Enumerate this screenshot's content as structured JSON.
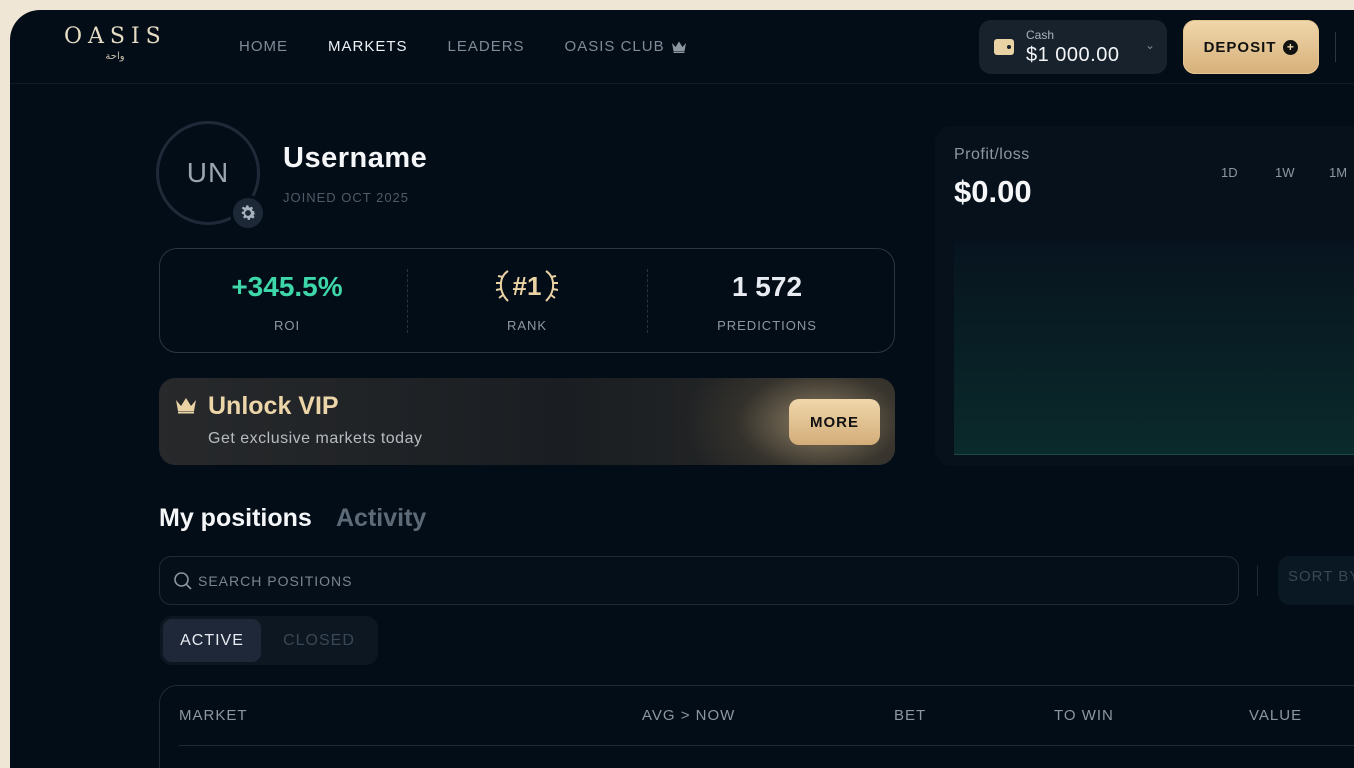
{
  "brand": {
    "name": "OASIS",
    "subtitle": "واحة"
  },
  "nav": {
    "home": "HOME",
    "markets": "MARKETS",
    "leaders": "LEADERS",
    "club": "OASIS CLUB",
    "active": "markets"
  },
  "cash": {
    "label": "Cash",
    "value": "$1 000.00"
  },
  "deposit": {
    "label": "DEPOSIT"
  },
  "profile": {
    "initials": "UN",
    "username": "Username",
    "joined": "JOINED OCT 2025"
  },
  "stats": {
    "roi": {
      "value": "+345.5%",
      "label": "ROI"
    },
    "rank": {
      "value": "#1",
      "label": "RANK"
    },
    "predictions": {
      "value": "1 572",
      "label": "PREDICTIONS"
    }
  },
  "vip": {
    "title": "Unlock VIP",
    "subtitle": "Get exclusive markets today",
    "button": "MORE"
  },
  "pnl": {
    "label": "Profit/loss",
    "value": "$0.00",
    "ranges": [
      "1D",
      "1W",
      "1M"
    ]
  },
  "positions": {
    "tabs": {
      "main": "My positions",
      "other": "Activity"
    },
    "search_placeholder": "SEARCH POSITIONS",
    "sort_label": "SORT BY",
    "filter": {
      "active": "ACTIVE",
      "closed": "CLOSED"
    },
    "columns": {
      "market": "MARKET",
      "avg_now": "AVG > NOW",
      "bet": "BET",
      "to_win": "TO WIN",
      "value": "VALUE"
    }
  },
  "colors": {
    "accent_gold": "#e9d2a4",
    "roi_green": "#3ed7a9",
    "background": "#030d17"
  }
}
